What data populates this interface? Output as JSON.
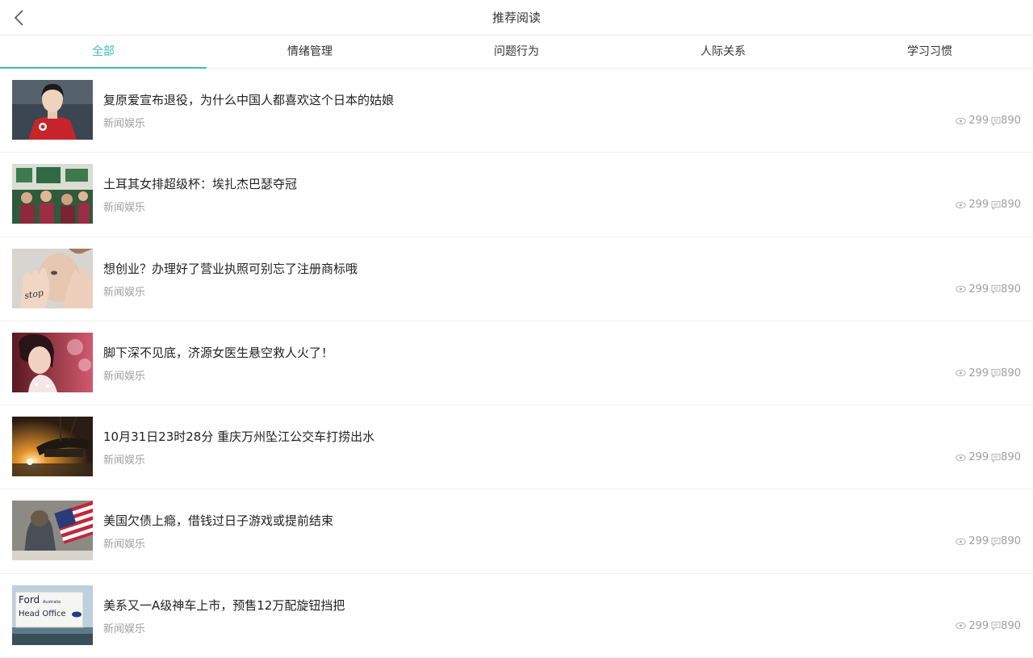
{
  "header": {
    "title": "推荐阅读",
    "back_icon": "chevron-left-icon"
  },
  "tabs": [
    {
      "label": "全部",
      "active": true
    },
    {
      "label": "情绪管理",
      "active": false
    },
    {
      "label": "问题行为",
      "active": false
    },
    {
      "label": "人际关系",
      "active": false
    },
    {
      "label": "学习习惯",
      "active": false
    }
  ],
  "accent_color": "#3fbcb8",
  "articles": [
    {
      "title": "复原爱宣布退役，为什么中国人都喜欢这个日本的姑娘",
      "category": "新闻娱乐",
      "views": "299",
      "comments": "890",
      "image": "table-tennis-player-photo"
    },
    {
      "title": "土耳其女排超级杯：埃扎杰巴瑟夺冠",
      "category": "新闻娱乐",
      "views": "299",
      "comments": "890",
      "image": "volleyball-team-photo"
    },
    {
      "title": "想创业？办理好了营业执照可别忘了注册商标哦",
      "category": "新闻娱乐",
      "views": "299",
      "comments": "890",
      "image": "child-hands-stop-photo"
    },
    {
      "title": "脚下深不见底，济源女医生悬空救人火了！",
      "category": "新闻娱乐",
      "views": "299",
      "comments": "890",
      "image": "woman-portrait-photo"
    },
    {
      "title": "10月31日23时28分 重庆万州坠江公交车打捞出水",
      "category": "新闻娱乐",
      "views": "299",
      "comments": "890",
      "image": "night-salvage-photo"
    },
    {
      "title": "美国欠债上瘾，借钱过日子游戏或提前结束",
      "category": "新闻娱乐",
      "views": "299",
      "comments": "890",
      "image": "man-american-flag-photo"
    },
    {
      "title": "美系又一A级神车上市，预售12万配旋钮挡把",
      "category": "新闻娱乐",
      "views": "299",
      "comments": "890",
      "image": "ford-head-office-sign-photo"
    }
  ],
  "thumb7_sign": {
    "line1": "Ford",
    "line2": "Head Office",
    "small": "Australia"
  },
  "thumb3_text": "stop"
}
